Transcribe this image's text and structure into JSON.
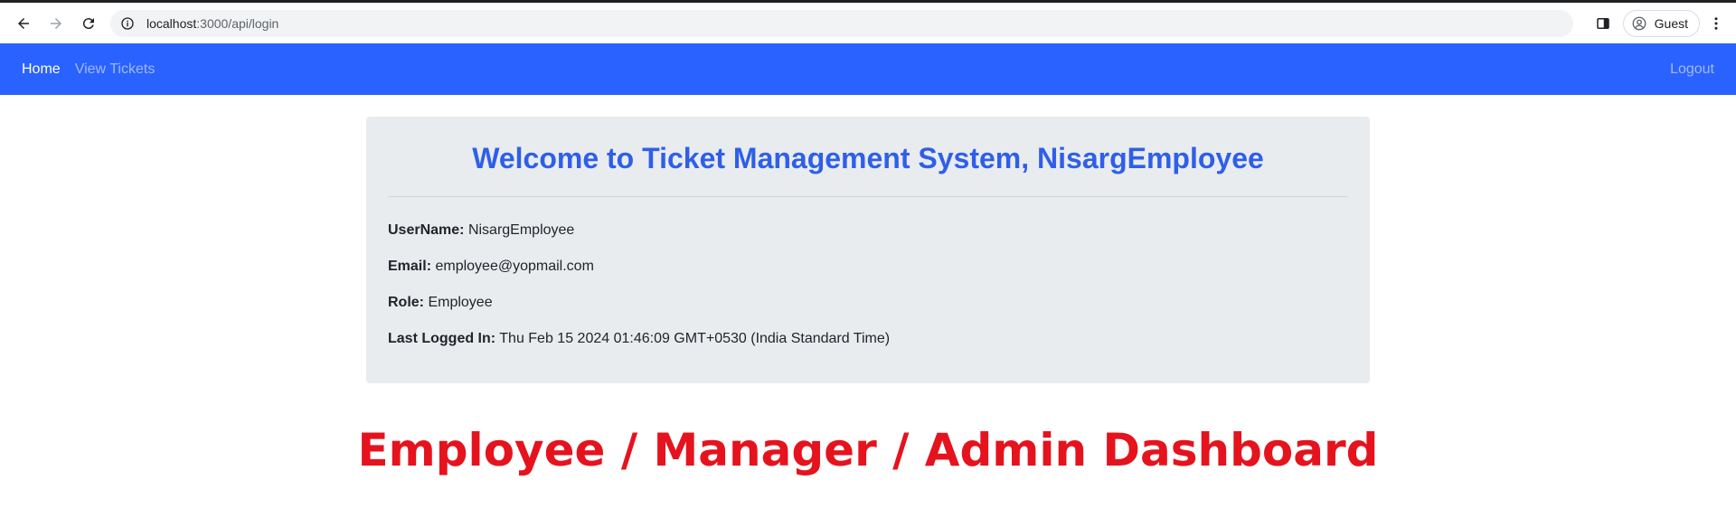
{
  "browser": {
    "url_host": "localhost",
    "url_rest": ":3000/api/login",
    "profile_label": "Guest"
  },
  "navbar": {
    "home_label": "Home",
    "tickets_label": "View Tickets",
    "logout_label": "Logout",
    "color": "#2962ff"
  },
  "card": {
    "welcome": "Welcome to Ticket Management System, NisargEmployee",
    "fields": [
      {
        "label": "UserName:",
        "value": "NisargEmployee"
      },
      {
        "label": "Email:",
        "value": "employee@yopmail.com"
      },
      {
        "label": "Role:",
        "value": "Employee"
      },
      {
        "label": "Last Logged In:",
        "value": "Thu Feb 15 2024 01:46:09 GMT+0530 (India Standard Time)"
      }
    ]
  },
  "dashboard_title": "Employee / Manager / Admin Dashboard"
}
